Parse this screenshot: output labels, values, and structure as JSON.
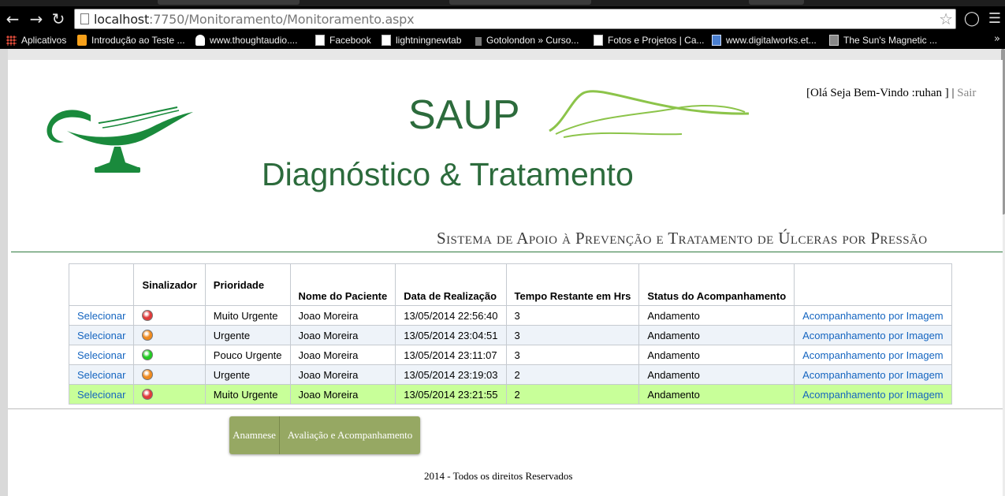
{
  "browser": {
    "url_host": "localhost",
    "url_path": ":7750/Monitoramento/Monitoramento.aspx",
    "bookmarks": [
      {
        "label": "Aplicativos",
        "icon": "apps-grid-icon"
      },
      {
        "label": "Introdução ao Teste ...",
        "icon": "hash-icon"
      },
      {
        "label": "www.thoughtaudio....",
        "icon": "bulb-icon"
      },
      {
        "label": "Facebook",
        "icon": "page-icon"
      },
      {
        "label": "lightningnewtab",
        "icon": "page-icon"
      },
      {
        "label": "Gotolondon » Curso...",
        "icon": "tower-icon"
      },
      {
        "label": "Fotos e Projetos | Ca...",
        "icon": "page-icon"
      },
      {
        "label": "www.digitalworks.et...",
        "icon": "digitalworks-icon"
      },
      {
        "label": "The Sun's Magnetic ...",
        "icon": "sun-icon"
      }
    ],
    "bookmarks_more": "»"
  },
  "header": {
    "brand": "SAUP",
    "subtitle": "Diagnóstico & Tratamento",
    "greeting": "[Olá Seja Bem-Vindo :ruhan ] | ",
    "logout": "Sair",
    "system_name": "Sistema de Apoio à Prevenção e Tratamento de Úlceras por Pressão"
  },
  "table": {
    "columns": [
      "",
      "Sinalizador",
      "Prioridade",
      "Nome do Paciente",
      "Data de Realização",
      "Tempo Restante em Hrs",
      "Status do Acompanhamento",
      ""
    ],
    "select_label": "Selecionar",
    "image_link_label": "Acompanhamento por Imagem",
    "rows": [
      {
        "signal": "red",
        "priority": "Muito Urgente",
        "patient": "Joao Moreira",
        "date": "13/05/2014 22:56:40",
        "hours": "3",
        "status": "Andamento"
      },
      {
        "signal": "orange",
        "priority": "Urgente",
        "patient": "Joao Moreira",
        "date": "13/05/2014 23:04:51",
        "hours": "3",
        "status": "Andamento"
      },
      {
        "signal": "green",
        "priority": "Pouco Urgente",
        "patient": "Joao Moreira",
        "date": "13/05/2014 23:11:07",
        "hours": "3",
        "status": "Andamento"
      },
      {
        "signal": "orange",
        "priority": "Urgente",
        "patient": "Joao Moreira",
        "date": "13/05/2014 23:19:03",
        "hours": "2",
        "status": "Andamento"
      },
      {
        "signal": "red",
        "priority": "Muito Urgente",
        "patient": "Joao Moreira",
        "date": "13/05/2014 23:21:55",
        "hours": "2",
        "status": "Andamento"
      }
    ],
    "selected_row_index": 4
  },
  "signal_colors": {
    "red": "#e03a3a",
    "orange": "#f08a1e",
    "green": "#22cc22"
  },
  "menu": [
    {
      "label": "Anamnese"
    },
    {
      "label": "Avaliação e Acompanhamento"
    }
  ],
  "footer": "2014 - Todos os direitos Reservados",
  "colors": {
    "brand_green": "#2c6b3c",
    "menu_green": "#96a863",
    "selected_row": "#c8ff99",
    "link_blue": "#1565c0"
  }
}
